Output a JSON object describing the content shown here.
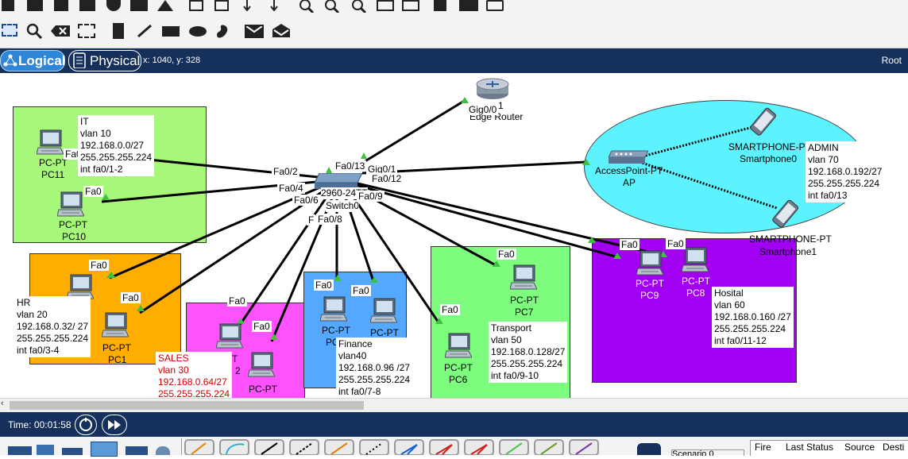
{
  "mode_bar": {
    "logical_label": "Logical",
    "physical_label": "Physical",
    "coordinates": "x: 1040, y: 328",
    "root_label": "Root"
  },
  "devices": {
    "router": {
      "model": "1",
      "name": "Edge Router",
      "port_gig": "Gig0/0"
    },
    "switch": {
      "model": "2960-24TT",
      "name": "Switch0",
      "ports": [
        "Fa0/2",
        "Fa0/13",
        "Gig0/1",
        "Fa0/12",
        "Fa0/4",
        "Fa0/6",
        "Fa0/9",
        "Fa0/8",
        "F"
      ]
    },
    "access_point": {
      "model": "AccessPoint-PT",
      "name": "AP"
    },
    "smartphone0": {
      "model": "SMARTPHONE-PT",
      "name": "Smartphone0"
    },
    "smartphone1": {
      "model": "SMARTPHONE-PT",
      "name": "Smartphone1"
    },
    "pc11": {
      "model": "PC-PT",
      "name": "PC11",
      "port": "Fa0"
    },
    "pc10": {
      "model": "PC-PT",
      "name": "PC10",
      "port": "Fa0"
    },
    "pc0": {
      "model": "PC-PT",
      "port": "Fa0"
    },
    "pc1": {
      "model": "PC-PT",
      "name": "PC1",
      "port": "Fa0"
    },
    "pc2": {
      "model": "PT",
      "name": "2",
      "port": "Fa0"
    },
    "pc3": {
      "model": "PC-PT",
      "port": "Fa0"
    },
    "pc4": {
      "model": "PC-PT",
      "name": "PC",
      "port": "Fa0"
    },
    "pc5": {
      "model": "PC-PT",
      "port": "Fa0"
    },
    "pc6": {
      "model": "PC-PT",
      "name": "PC6",
      "port": "Fa0"
    },
    "pc7": {
      "model": "PC-PT",
      "name": "PC7",
      "port": "Fa0"
    },
    "pc9": {
      "model": "PC-PT",
      "name": "PC9",
      "port": "Fa0"
    },
    "pc8": {
      "model": "PC-PT",
      "name": "PC8",
      "port": "Fa0"
    }
  },
  "vlans": {
    "it": {
      "name": "IT",
      "vlan": "vlan 10",
      "network": "192.168.0.0/27",
      "mask": "255.255.255.224",
      "ports": "int fa0/1-2"
    },
    "hr": {
      "name": "HR",
      "vlan": "vlan 20",
      "network": "192.168.0.32/ 27",
      "mask": "255.255.255.224",
      "ports": "int fa0/3-4"
    },
    "sales": {
      "name": "SALES",
      "vlan": "vlan 30",
      "network": "192.168.0.64/27",
      "mask": "255.255.255.224"
    },
    "finance": {
      "name": "Finance",
      "vlan": "vlan40",
      "network": "192.168.0.96 /27",
      "mask": "255.255.255.224",
      "ports": "int fa0/7-8"
    },
    "transport": {
      "name": "Transport",
      "vlan": "vlan 50",
      "network": "192.168.0.128/27",
      "mask": "255.255.255.224",
      "ports": "int fa0/9-10"
    },
    "hospital": {
      "name": "Hosital",
      "vlan": "vlan 60",
      "network": "192.168.0.160 /27",
      "mask": "255.255.255.224",
      "ports": "int fa0/11-12"
    },
    "admin": {
      "name": "ADMIN",
      "vlan": "vlan 70",
      "network": "192.168.0.192/27",
      "mask": "255.255.255.224",
      "ports": "int fa0/13"
    }
  },
  "time_bar": {
    "time": "Time: 00:01:58"
  },
  "bottom": {
    "scenario": "Scenario 0",
    "columns": [
      "Fire",
      "Last Status",
      "Source",
      "Desti"
    ]
  },
  "colors": {
    "nav_bg": "#16305c",
    "it_zone": "#a6f77a",
    "hr_zone": "#ffad00",
    "sales_zone": "#ff52ff",
    "finance_zone": "#54a8ff",
    "transport_zone": "#7dfc7d",
    "hospital_zone": "#a100f2",
    "wireless_zone": "#5cf3ff",
    "sales_text": "#d00000"
  }
}
